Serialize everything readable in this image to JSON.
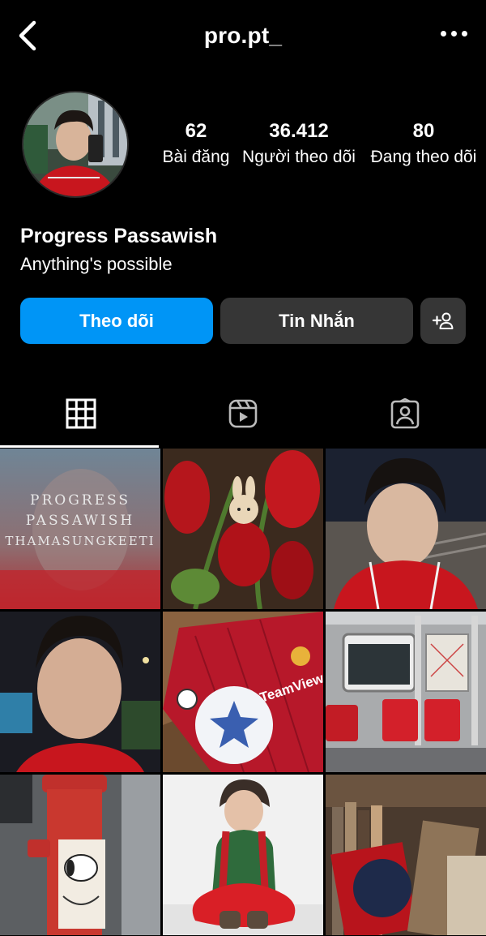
{
  "header": {
    "username": "pro.pt_"
  },
  "profile": {
    "posts_count": "62",
    "posts_label": "Bài đăng",
    "followers_count": "36.412",
    "followers_label": "Người theo dõi",
    "following_count": "80",
    "following_label": "Đang theo dõi",
    "display_name": "Progress Passawish",
    "bio": "Anything's possible"
  },
  "actions": {
    "follow_label": "Theo dõi",
    "message_label": "Tin Nhắn",
    "add_user_icon": "add-user-icon"
  },
  "tabs": [
    {
      "name": "grid",
      "icon": "grid-icon",
      "active": true
    },
    {
      "name": "reels",
      "icon": "reels-icon",
      "active": false
    },
    {
      "name": "tagged",
      "icon": "tagged-icon",
      "active": false
    }
  ],
  "posts": {
    "post_1_caption_line1": "PROGRESS",
    "post_1_caption_line2": "PASSAWISH",
    "post_1_caption_line3": "THAMASUNGKEETI",
    "post_5_sponsor": "TeamViewer"
  },
  "colors": {
    "accent_blue": "#0095f6",
    "button_gray": "#363636",
    "background": "#000000"
  }
}
